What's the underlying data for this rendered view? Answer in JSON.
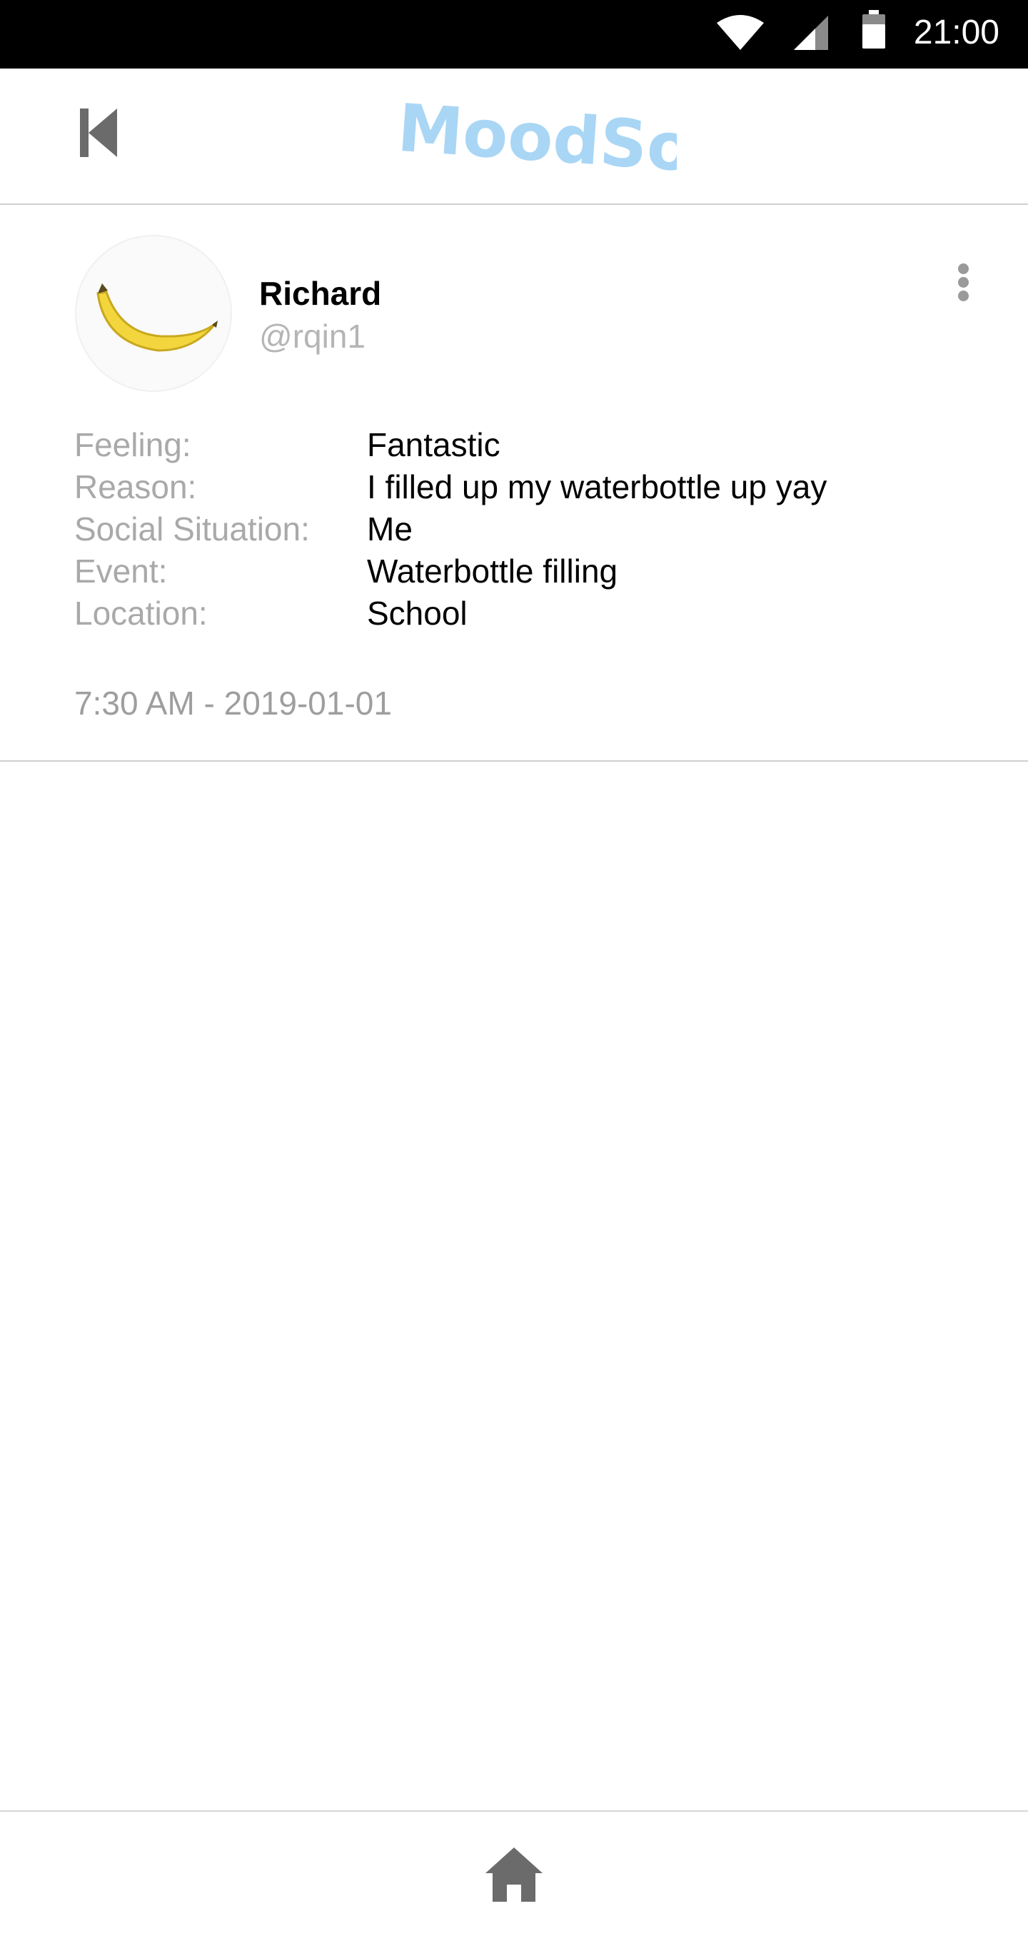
{
  "status_bar": {
    "time": "21:00",
    "icons": [
      "wifi-icon",
      "cell-signal-icon",
      "battery-icon"
    ]
  },
  "app_bar": {
    "logo_text": "MoodSoup",
    "back_icon": "skip-back-icon"
  },
  "post": {
    "user": {
      "name": "Richard",
      "handle": "@rqin1",
      "avatar": "banana-icon"
    },
    "details": [
      {
        "label": "Feeling:",
        "value": "Fantastic"
      },
      {
        "label": "Reason:",
        "value": "I filled up my waterbottle up yay"
      },
      {
        "label": "Social Situation:",
        "value": "Me"
      },
      {
        "label": "Event:",
        "value": "Waterbottle filling"
      },
      {
        "label": "Location:",
        "value": "School"
      }
    ],
    "timestamp": "7:30 AM - 2019-01-01"
  },
  "bottom_nav": {
    "home_icon": "home-icon"
  },
  "colors": {
    "logo": "#a9d6f5",
    "icon_gray": "#6b6b6b",
    "label_gray": "#a9a9a9",
    "divider": "#cfcfcf"
  }
}
